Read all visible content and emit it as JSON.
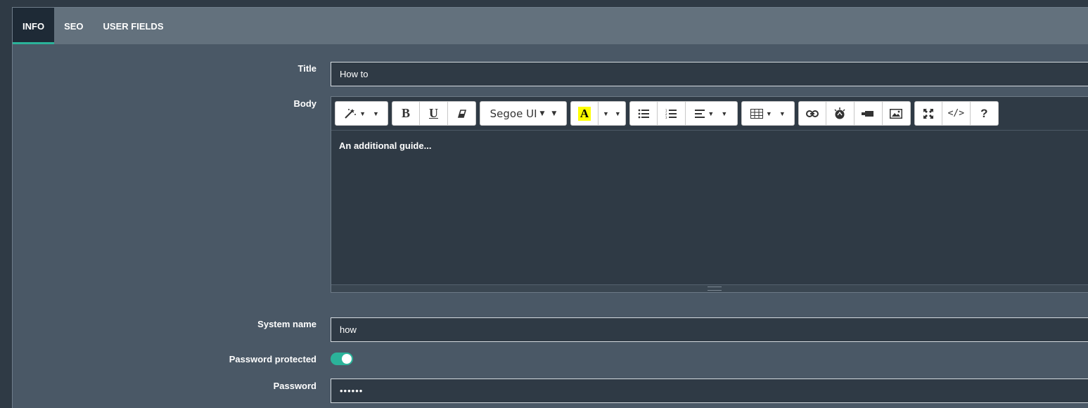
{
  "tabs": [
    {
      "label": "INFO",
      "active": true
    },
    {
      "label": "SEO",
      "active": false
    },
    {
      "label": "USER FIELDS",
      "active": false
    }
  ],
  "form": {
    "title_label": "Title",
    "title_value": "How to",
    "body_label": "Body",
    "body_content": "An additional guide...",
    "system_name_label": "System name",
    "system_name_value": "how",
    "password_protected_label": "Password protected",
    "password_protected": true,
    "password_label": "Password",
    "password_value": "••••••"
  },
  "toolbar": {
    "font_name": "Segoe UI",
    "highlight_letter": "A",
    "bold_letter": "B",
    "underline_letter": "U",
    "help_symbol": "?",
    "code_symbol": "</>",
    "icons": [
      "magic-wand-icon",
      "bold-icon",
      "underline-icon",
      "eraser-icon",
      "font-name-dropdown",
      "highlight-color-icon",
      "unordered-list-icon",
      "ordered-list-icon",
      "align-icon",
      "table-icon",
      "link-icon",
      "picture-icon",
      "video-icon",
      "image-icon",
      "fullscreen-icon",
      "code-view-icon",
      "help-icon"
    ]
  },
  "colors": {
    "accent": "#2bb39a",
    "panel": "#4a5866",
    "tab_bar": "#63717d",
    "active_tab": "#1e2a36",
    "input_bg": "#2f3a45",
    "highlight": "#ffff00"
  }
}
